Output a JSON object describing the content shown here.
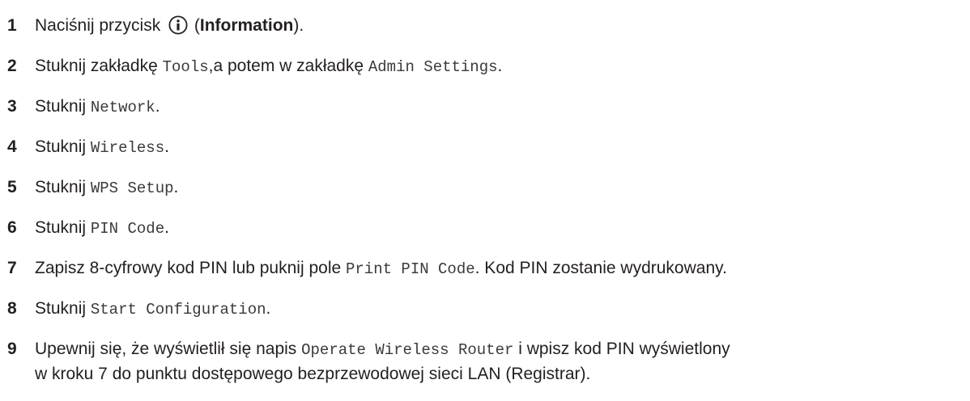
{
  "steps": [
    {
      "num": "1",
      "t1": "Naciśnij przycisk ",
      "icon": "info-circle-icon",
      "t2": " (",
      "b1": "Information",
      "t3": ")."
    },
    {
      "num": "2",
      "t1": "Stuknij zakładkę ",
      "m1": "Tools",
      "t2": ",a potem w zakładkę ",
      "m2": "Admin Settings",
      "t3": "."
    },
    {
      "num": "3",
      "t1": "Stuknij ",
      "m1": "Network",
      "t2": "."
    },
    {
      "num": "4",
      "t1": "Stuknij ",
      "m1": "Wireless",
      "t2": "."
    },
    {
      "num": "5",
      "t1": "Stuknij ",
      "m1": "WPS Setup",
      "t2": "."
    },
    {
      "num": "6",
      "t1": "Stuknij ",
      "m1": "PIN Code",
      "t2": "."
    },
    {
      "num": "7",
      "t1": "Zapisz 8-cyfrowy kod PIN lub puknij pole ",
      "m1": "Print PIN Code",
      "t2": ". Kod PIN zostanie wydrukowany."
    },
    {
      "num": "8",
      "t1": "Stuknij ",
      "m1": "Start Configuration",
      "t2": "."
    },
    {
      "num": "9",
      "t1": "Upewnij się, że wyświetlił się napis ",
      "m1": "Operate Wireless Router",
      "t2": " i wpisz kod PIN wyświetlony",
      "line2": "w kroku 7 do punktu dostępowego bezprzewodowej sieci LAN (Registrar)."
    }
  ]
}
